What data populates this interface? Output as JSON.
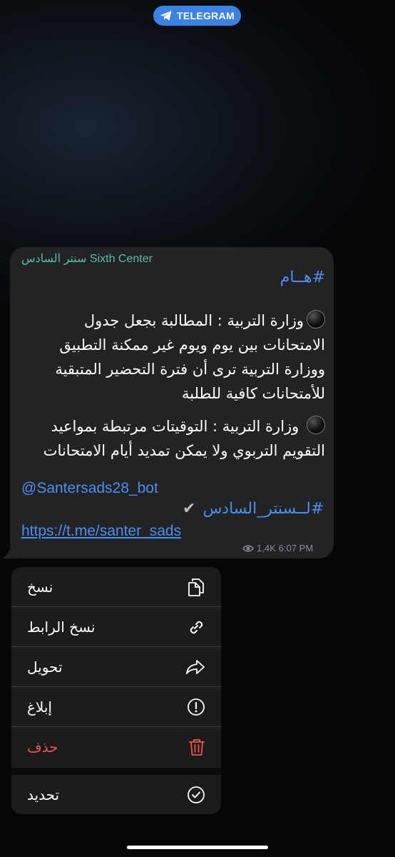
{
  "badge": {
    "label": "TELEGRAM",
    "icon": "telegram-icon"
  },
  "message": {
    "sender": "سنتر السادس Sixth Center",
    "title_hashtag": "#هــام",
    "para1": [
      "وزارة التربية : المطالبة بجعل جدول",
      "الامتحانات بين يوم ويوم غير ممكنة التطبيق",
      "ووزارة التربية ترى أن فترة التحضير المتبقية",
      "للأمتحانات كافية للطلبة"
    ],
    "para2": [
      "وزارة التربية : التوقيتات مرتبطة بمواعيد",
      "التقويم التربوي ولا يمكن تمديد أيام الامتحانات"
    ],
    "bot_mention": "@Santersads28_bot",
    "footer_hashtag": "#لــسنتر_السادس",
    "link": "https://t.me/santer_sads",
    "views": "1,4K",
    "time": "6:07 PM"
  },
  "menu": {
    "items": [
      {
        "label": "نسخ",
        "icon": "copy-icon"
      },
      {
        "label": "نسخ الرابط",
        "icon": "link-icon"
      },
      {
        "label": "تحويل",
        "icon": "forward-icon"
      },
      {
        "label": "إبلاغ",
        "icon": "report-icon"
      },
      {
        "label": "حذف",
        "icon": "trash-icon"
      },
      {
        "label": "تحديد",
        "icon": "select-icon"
      }
    ]
  },
  "colors": {
    "accent": "#4b8ff0",
    "danger": "#eb5545",
    "sender": "#4fc3a1"
  }
}
